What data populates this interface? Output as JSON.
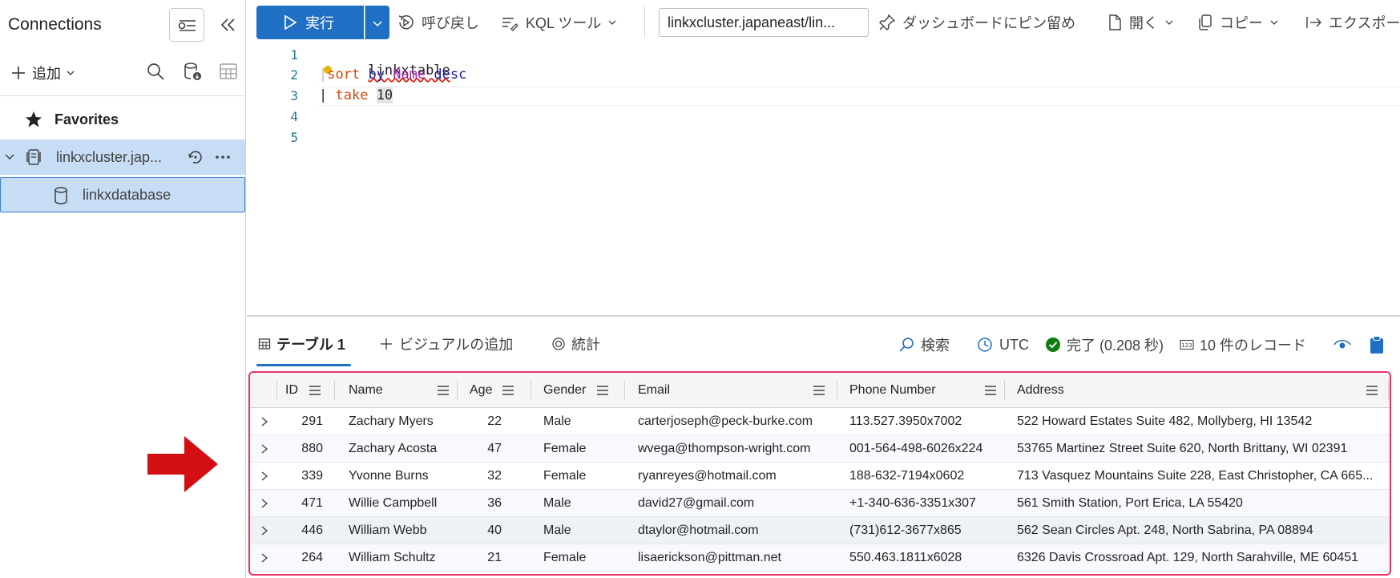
{
  "sidebar": {
    "title": "Connections",
    "add_label": "追加",
    "favorites_label": "Favorites",
    "cluster_label": "linkxcluster.jap...",
    "database_label": "linkxdatabase"
  },
  "toolbar": {
    "run_label": "実行",
    "recall_label": "呼び戻し",
    "kql_tools_label": "KQL ツール",
    "cluster_value": "linkxcluster.japaneast/lin...",
    "pin_label": "ダッシュボードにピン留め",
    "open_label": "開く",
    "copy_label": "コピー",
    "export_label": "エクスポー"
  },
  "editor": {
    "lines": [
      {
        "no": "1"
      },
      {
        "no": "2"
      },
      {
        "no": "3"
      },
      {
        "no": "4"
      },
      {
        "no": "5"
      }
    ],
    "line1": "linkxtable",
    "line2_op": "sort",
    "line2_by": "by",
    "line2_col": "Name",
    "line2_dir": "desc",
    "line3_pipe": "| ",
    "line3_op": "take",
    "line3_num": "10"
  },
  "results": {
    "tab_table": "テーブル 1",
    "tab_add_visual": "ビジュアルの追加",
    "tab_stats": "統計",
    "search_label": "検索",
    "tz_label": "UTC",
    "status_label": "完了 (0.208 秒)",
    "records_label": "10 件のレコード"
  },
  "grid": {
    "columns": [
      "ID",
      "Name",
      "Age",
      "Gender",
      "Email",
      "Phone Number",
      "Address"
    ],
    "rows": [
      [
        "291",
        "Zachary Myers",
        "22",
        "Male",
        "carterjoseph@peck-burke.com",
        "113.527.3950x7002",
        "522 Howard Estates Suite 482, Mollyberg, HI 13542"
      ],
      [
        "880",
        "Zachary Acosta",
        "47",
        "Female",
        "wvega@thompson-wright.com",
        "001-564-498-6026x224",
        "53765 Martinez Street Suite 620, North Brittany, WI 02391"
      ],
      [
        "339",
        "Yvonne Burns",
        "32",
        "Female",
        "ryanreyes@hotmail.com",
        "188-632-7194x0602",
        "713 Vasquez Mountains Suite 228, East Christopher, CA 665..."
      ],
      [
        "471",
        "Willie Campbell",
        "36",
        "Male",
        "david27@gmail.com",
        "+1-340-636-3351x307",
        "561 Smith Station, Port Erica, LA 55420"
      ],
      [
        "446",
        "William Webb",
        "40",
        "Male",
        "dtaylor@hotmail.com",
        "(731)612-3677x865",
        "562 Sean Circles Apt. 248, North Sabrina, PA 08894"
      ],
      [
        "264",
        "William Schultz",
        "21",
        "Female",
        "lisaerickson@pittman.net",
        "550.463.1811x6028",
        "6326 Davis Crossroad Apt. 129, North Sarahville, ME 60451"
      ]
    ]
  },
  "colors": {
    "accent": "#1f6fc5",
    "selection": "#c7ddf6",
    "highlight_border": "#e8336b",
    "arrow": "#d40f14",
    "success": "#107c10"
  }
}
